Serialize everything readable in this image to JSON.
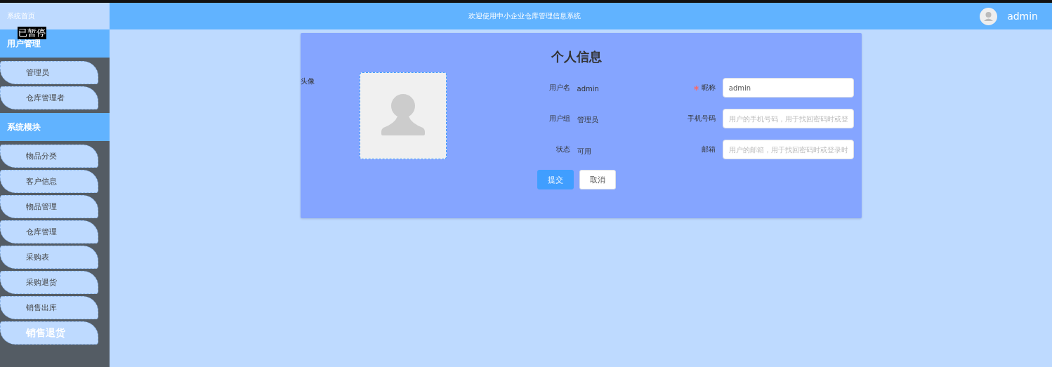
{
  "sidebar": {
    "home": "系统首页",
    "sections": [
      {
        "title": "用户管理",
        "items": [
          {
            "label": "管理员",
            "selected": false
          },
          {
            "label": "仓库管理者",
            "selected": false
          }
        ]
      },
      {
        "title": "系统模块",
        "items": [
          {
            "label": "物品分类",
            "selected": false
          },
          {
            "label": "客户信息",
            "selected": false
          },
          {
            "label": "物品管理",
            "selected": false
          },
          {
            "label": "仓库管理",
            "selected": false
          },
          {
            "label": "采购表",
            "selected": false
          },
          {
            "label": "采购退货",
            "selected": false
          },
          {
            "label": "销售出库",
            "selected": false
          },
          {
            "label": "销售退货",
            "selected": true
          }
        ]
      }
    ]
  },
  "overlay": "已暂停",
  "header": {
    "title": "欢迎使用中小企业仓库管理信息系统",
    "user": "admin"
  },
  "form": {
    "title": "个人信息",
    "avatar_label": "头像",
    "info": [
      {
        "label": "用户名",
        "value": "admin"
      },
      {
        "label": "用户组",
        "value": "管理员"
      },
      {
        "label": "状态",
        "value": "可用"
      }
    ],
    "fields": [
      {
        "label": "昵称",
        "required": true,
        "value": "admin"
      },
      {
        "label": "手机号码",
        "required": false,
        "placeholder": "用户的手机号码，用于找回密码时或登"
      },
      {
        "label": "邮箱",
        "required": false,
        "placeholder": "用户的邮箱，用于找回密码时或登录时"
      }
    ],
    "buttons": [
      {
        "label": "提交",
        "kind": "primary"
      },
      {
        "label": "取消",
        "kind": "plain"
      }
    ]
  }
}
